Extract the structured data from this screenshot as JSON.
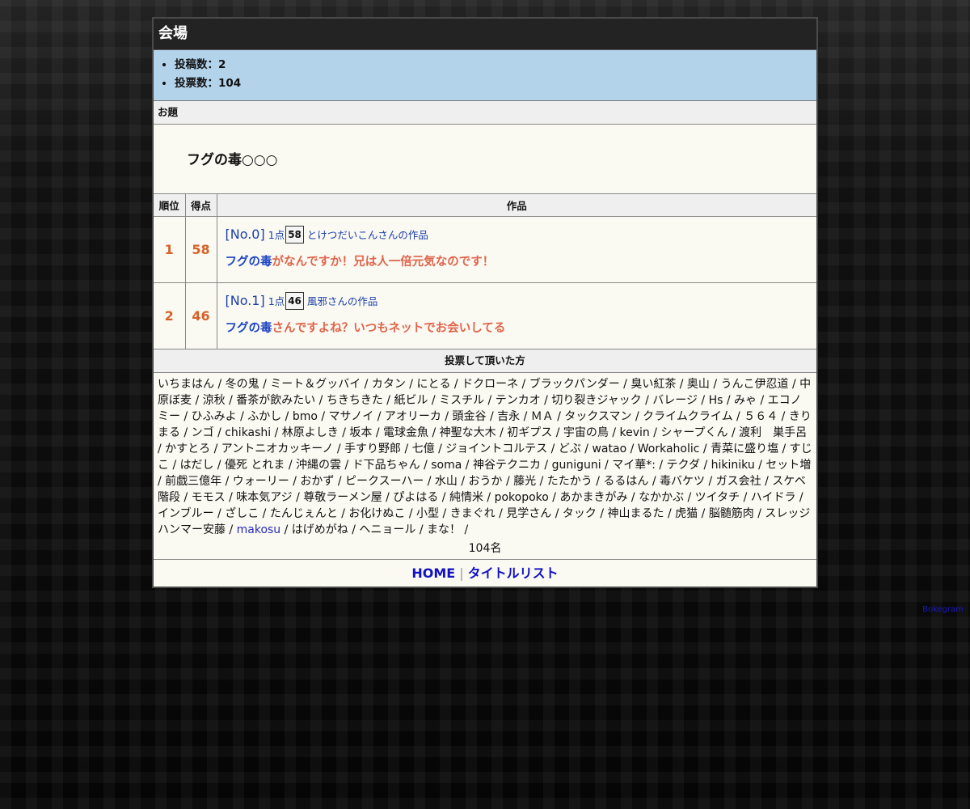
{
  "venue": {
    "title": "会場",
    "stats": [
      "投稿数：2",
      "投票数：104"
    ]
  },
  "odai": {
    "header": "お題",
    "text": "フグの毒○○○"
  },
  "results": {
    "headers": {
      "rank": "順位",
      "score": "得点",
      "work": "作品"
    },
    "entries": [
      {
        "rank": "1",
        "score": "58",
        "no": "[No.0]",
        "pt_label": "1点",
        "pt_value": "58",
        "author": "とけつだいこんさんの作品",
        "keyword": "フグの毒",
        "answer": "がなんですか！兄は人一倍元気なのです！"
      },
      {
        "rank": "2",
        "score": "46",
        "no": "[No.1]",
        "pt_label": "1点",
        "pt_value": "46",
        "author": "風邪さんの作品",
        "keyword": "フグの毒",
        "answer": "さんですよね？いつもネットでお会いしてる"
      }
    ]
  },
  "voters": {
    "header": "投票して頂いた方",
    "part1": "いちまはん / 冬の鬼 / ミート＆グッバイ / カタン / にとる / ドクローネ / ブラックパンダー / 臭い紅茶 / 奥山 / うんこ伊忍道 / 中原ぼ麦 / 涼秋 / 番茶が飲みたい / ちきちきた / 紙ビル / ミスチル / テンカオ / 切り裂きジャック / バレージ / Hs / みゃ / エコノミー / ひふみよ / ふかし / bmo / マサノイ / アオリーカ / 頭金谷 / 吉永 / ＭＡ / タックスマン / クライムクライム / ５６４ / きりまる / ンゴ / chikashi / 林原よしき / 坂本 / 電球金魚 / 神聖な大木 / 初ギプス / 宇宙の鳥 / kevin / シャープくん / 渡利　巣手呂 / かすとろ / アントニオカッキーノ / 手すり野郎 / 七億 / ジョイントコルテス / どぶ / watao / Workaholic / 青菜に盛り塩 / すじこ / はだし / 優死 とれま / 沖縄の雲 / ド下品ちゃん / soma / 神谷テクニカ / guniguni / マイ華*: / テクダ / hikiniku / セット増 / 前戯三億年 / ウォーリー / おかず / ピークスーハー / 水山 / おうか / 藤光 / たたかう / るるはん / 毒バケツ / ガス会社 / スケベ階段 / モモス / 味本気アジ / 尊敬ラーメン屋 / ぴよはる / 純情米 / pokopoko / あかまきがみ / なかかぶ / ツイタチ / ハイドラ / インブルー / ざしこ / たんじぇんと / お化けぬこ / 小型 / きまぐれ / 見学さん / タック / 神山まるた / 虎猫 / 脳髄筋肉 / スレッジハンマー安藤 / ",
    "link_name": "makosu",
    "part2": " / はげめがね / ヘニョール / まな！ /",
    "count": "104名"
  },
  "footer": {
    "home": "HOME",
    "separator": "|",
    "title_list": "タイトルリスト"
  },
  "credit": "Bokegram"
}
